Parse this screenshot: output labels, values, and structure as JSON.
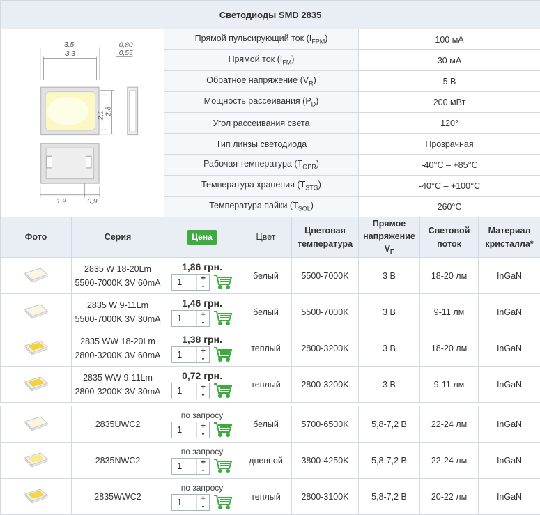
{
  "title": "Светодиоды SMD 2835",
  "drawing": {
    "d1": "3,5",
    "d2": "3,3",
    "d3": "0,80",
    "d4": "0,55",
    "d5": "2,1",
    "d6": "2,8",
    "d7": "1,9",
    "d8": "0,9"
  },
  "specs": [
    {
      "name": "Прямой пульсирующий ток (I",
      "sub": "FPM",
      "value": "100 мА"
    },
    {
      "name": "Прямой ток (I",
      "sub": "FM",
      "value": "30 мА"
    },
    {
      "name": "Обратное напряжение (V",
      "sub": "R",
      "value": "5 В"
    },
    {
      "name": "Мощность рассеивания (P",
      "sub": "D",
      "value": "200 мВт"
    },
    {
      "name": "Угол рассеивания света",
      "sub": "",
      "value": "120°"
    },
    {
      "name": "Тип линзы светодиода",
      "sub": "",
      "value": "Прозрачная"
    },
    {
      "name": "Рабочая температура (T",
      "sub": "OPR",
      "value": "-40°C – +85°C"
    },
    {
      "name": "Температура хранения (T",
      "sub": "STG",
      "value": "-40°C – +100°C"
    },
    {
      "name": "Температура пайки (T",
      "sub": "SOL",
      "value": "260°C"
    }
  ],
  "header": {
    "photo": "Фото",
    "series": "Серия",
    "price": "Цена",
    "color": "Цвет",
    "cct": "Цветовая температура",
    "vf": "Прямое напряжение V",
    "vf_sub": "F",
    "flux": "Световой поток",
    "material": "Материал кристалла*"
  },
  "products_group1": [
    {
      "series1": "2835 W 18-20Lm",
      "series2": "5500-7000K 3V 60mA",
      "price": "1,86 грн.",
      "qty": "1",
      "color": "белый",
      "cct": "5500-7000K",
      "vf": "3 В",
      "flux": "18-20 лм",
      "material": "InGaN",
      "led": "#fbf7df"
    },
    {
      "series1": "2835 W 9-11Lm",
      "series2": "5500-7000K 3V 30mA",
      "price": "1,46 грн.",
      "qty": "1",
      "color": "белый",
      "cct": "5500-7000K",
      "vf": "3 В",
      "flux": "9-11 лм",
      "material": "InGaN",
      "led": "#fbf7df"
    },
    {
      "series1": "2835 WW 18-20Lm",
      "series2": "2800-3200K 3V 60mA",
      "price": "1,38 грн.",
      "qty": "1",
      "color": "теплый",
      "cct": "2800-3200K",
      "vf": "3 В",
      "flux": "18-20 лм",
      "material": "InGaN",
      "led": "#f5d23a"
    },
    {
      "series1": "2835 WW 9-11Lm",
      "series2": "2800-3200K 3V 30mA",
      "price": "0,72 грн.",
      "qty": "1",
      "color": "теплый",
      "cct": "2800-3200K",
      "vf": "3 В",
      "flux": "9-11 лм",
      "material": "InGaN",
      "led": "#f5d23a"
    }
  ],
  "products_group2": [
    {
      "series": "2835UWC2",
      "price": "по запросу",
      "qty": "1",
      "color": "белый",
      "cct": "5700-6500K",
      "vf": "5,8-7,2 В",
      "flux": "22-24 лм",
      "material": "InGaN",
      "led": "#fbf6d6"
    },
    {
      "series": "2835NWC2",
      "price": "по запросу",
      "qty": "1",
      "color": "дневной",
      "cct": "3800-4250K",
      "vf": "5,8-7,2 В",
      "flux": "22-24 лм",
      "material": "InGaN",
      "led": "#f7eb8c"
    },
    {
      "series": "2835WWC2",
      "price": "по запросу",
      "qty": "1",
      "color": "теплый",
      "cct": "2800-3100K",
      "vf": "5,8-7,2 В",
      "flux": "20-22 лм",
      "material": "InGaN",
      "led": "#f3d54e"
    }
  ],
  "colors": {
    "border": "#d2d9e0",
    "header_bg": "#e8eef3",
    "accent_green": "#3faa3f"
  }
}
